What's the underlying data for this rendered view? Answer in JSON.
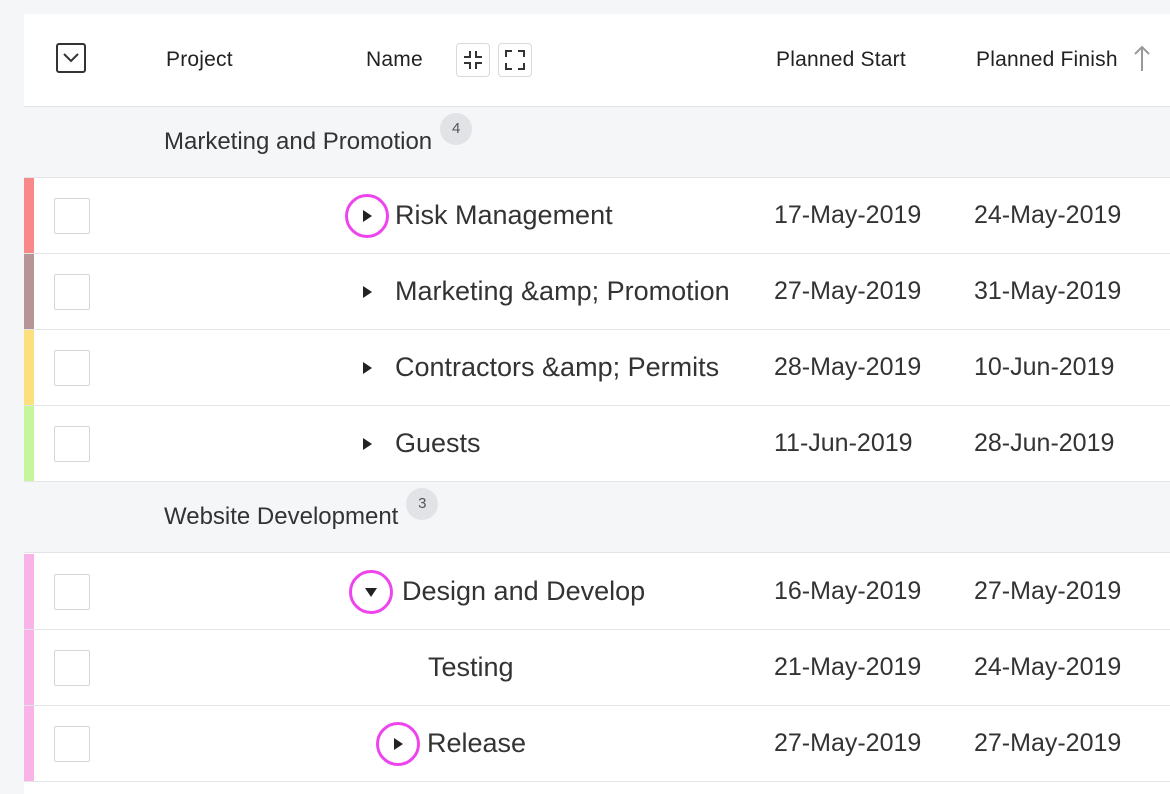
{
  "header": {
    "project_label": "Project",
    "name_label": "Name",
    "planned_start_label": "Planned Start",
    "planned_finish_label": "Planned Finish",
    "icons": {
      "select_all": "chevron-down-in-square-icon",
      "collapse_all": "collapse-icon",
      "expand_all": "expand-icon",
      "sort": "sort-ascending-arrow-icon"
    }
  },
  "groups": [
    {
      "label": "Marketing and Promotion",
      "count": "4",
      "rows": [
        {
          "name": "Risk Management",
          "start": "17-May-2019",
          "finish": "24-May-2019",
          "color": "#f98989",
          "toggle": "collapsed",
          "highlighted": true
        },
        {
          "name": "Marketing &amp; Promotion",
          "start": "27-May-2019",
          "finish": "31-May-2019",
          "color": "#b59595",
          "toggle": "collapsed",
          "highlighted": false
        },
        {
          "name": "Contractors &amp; Permits",
          "start": "28-May-2019",
          "finish": "10-Jun-2019",
          "color": "#fde07e",
          "toggle": "collapsed",
          "highlighted": false
        },
        {
          "name": "Guests",
          "start": "11-Jun-2019",
          "finish": "28-Jun-2019",
          "color": "#c5f59c",
          "toggle": "collapsed",
          "highlighted": false
        }
      ]
    },
    {
      "label": "Website Development",
      "count": "3",
      "rows": [
        {
          "name": "Design and Develop",
          "start": "16-May-2019",
          "finish": "27-May-2019",
          "color": "#f9b3e6",
          "toggle": "expanded",
          "highlighted": true
        },
        {
          "name": "Testing",
          "start": "21-May-2019",
          "finish": "24-May-2019",
          "color": "#f9b3e6",
          "toggle": "none",
          "highlighted": false
        },
        {
          "name": "Release",
          "start": "27-May-2019",
          "finish": "27-May-2019",
          "color": "#f9b3e6",
          "toggle": "collapsed",
          "highlighted": true
        }
      ]
    }
  ],
  "colors": {
    "highlight_ring": "#ee44ee",
    "row_border": "#e2e4e8",
    "group_background": "#f5f6f8"
  }
}
